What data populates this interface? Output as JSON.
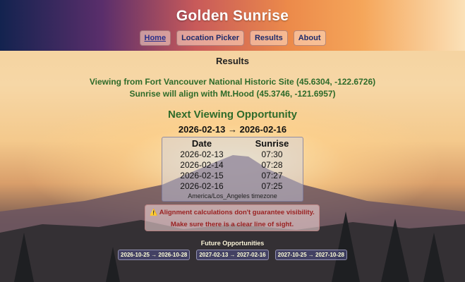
{
  "header": {
    "title": "Golden Sunrise",
    "nav": [
      {
        "label": "Home"
      },
      {
        "label": "Location Picker"
      },
      {
        "label": "Results"
      },
      {
        "label": "About"
      }
    ]
  },
  "results": {
    "heading": "Results",
    "viewing_line": "Viewing from Fort Vancouver National Historic Site (45.6304, -122.6726)",
    "align_line": "Sunrise will align with Mt.Hood (45.3746, -121.6957)",
    "next_heading": "Next Viewing Opportunity",
    "range": "2026-02-13 → 2026-02-16",
    "table": {
      "headers": [
        "Date",
        "Sunrise"
      ],
      "rows": [
        [
          "2026-02-13",
          "07:30"
        ],
        [
          "2026-02-14",
          "07:28"
        ],
        [
          "2026-02-15",
          "07:27"
        ],
        [
          "2026-02-16",
          "07:25"
        ]
      ],
      "timezone": "America/Los_Angeles timezone"
    },
    "warning": {
      "line1": "Alignment calculations don't guarantee visibility.",
      "line2": "Make sure there is a clear line of sight.",
      "icon": "warning-icon"
    },
    "future_heading": "Future Opportunities",
    "future": [
      "2026-10-25 → 2026-10-28",
      "2027-02-13 → 2027-02-16",
      "2027-10-25 → 2027-10-28"
    ]
  },
  "colors": {
    "accent_green": "#2f6b2a",
    "nav_link": "#2a2f8a",
    "warning_text": "#9a2222"
  }
}
